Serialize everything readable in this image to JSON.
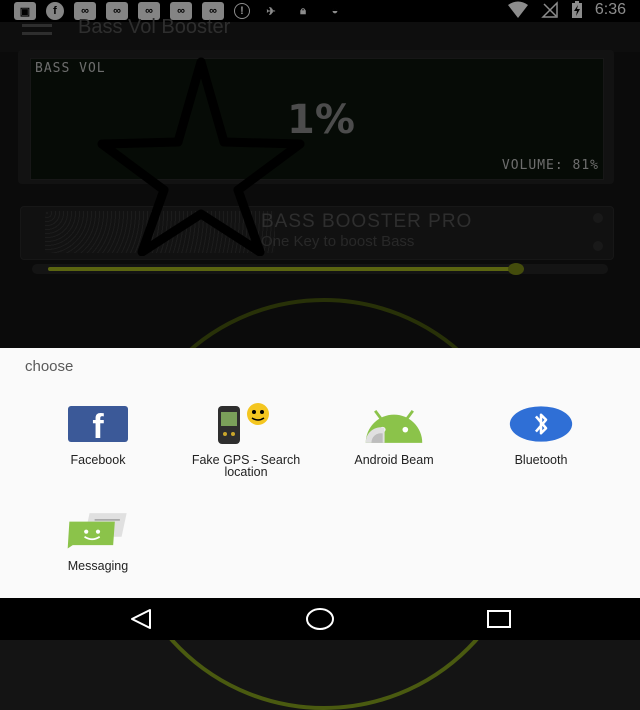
{
  "status_bar": {
    "time": "6:36",
    "left_icons": [
      "app-icon",
      "facebook-icon",
      "voicemail-icon",
      "voicemail-icon",
      "voicemail-icon",
      "voicemail-icon",
      "voicemail-icon",
      "info-icon",
      "fake-gps-icon",
      "lock-icon",
      "android-icon"
    ],
    "right_icons": [
      "wifi-icon",
      "no-signal-icon",
      "battery-charging-icon"
    ]
  },
  "background_app": {
    "title": "Bass Vol Booster",
    "display_label": "BASS VOL",
    "percent": "1%",
    "volume_readout": "VOLUME: 81%",
    "promo_title": "BASS BOOSTER PRO",
    "promo_subtitle": "One Key to boost Bass",
    "slider_fraction": 0.84,
    "accent": "#a6b81f"
  },
  "chooser": {
    "title": "choose",
    "apps": [
      {
        "label": "Facebook",
        "icon": "facebook-icon"
      },
      {
        "label": "Fake GPS - Search location",
        "icon": "gps-device-icon"
      },
      {
        "label": "Android Beam",
        "icon": "android-beam-icon"
      },
      {
        "label": "Bluetooth",
        "icon": "bluetooth-icon"
      },
      {
        "label": "Messaging",
        "icon": "messaging-icon"
      }
    ]
  },
  "nav_bar": {
    "buttons": [
      "back-icon",
      "home-icon",
      "recents-icon"
    ]
  }
}
